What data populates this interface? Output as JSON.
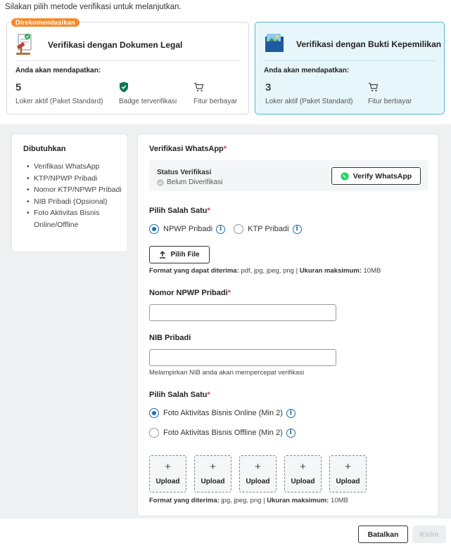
{
  "intro": "Silakan pilih metode verifikasi untuk melanjutkan.",
  "cards": {
    "legal": {
      "badge": "Direkomendasikan",
      "title": "Verifikasi dengan Dokumen Legal",
      "subtitle": "Anda akan mendapatkan:",
      "benefit_count": "5",
      "benefit_count_label": "Loker aktif (Paket Standard)",
      "badge_label": "Badge terverifikasi",
      "paid_label": "Fitur berbayar"
    },
    "owner": {
      "title": "Verifikasi dengan Bukti Kepemilikan",
      "subtitle": "Anda akan mendapatkan:",
      "benefit_count": "3",
      "benefit_count_label": "Loker aktif (Paket Standard)",
      "paid_label": "Fitur berbayar",
      "selected": true
    }
  },
  "sidebar": {
    "title": "Dibutuhkan",
    "items": [
      "Verifikasi WhatsApp",
      "KTP/NPWP Pribadi",
      "Nomor KTP/NPWP Pribadi",
      "NIB Pribadi (Opsional)",
      "Foto Aktivitas Bisnis Online/Offline"
    ]
  },
  "form": {
    "whatsapp": {
      "title": "Verifikasi WhatsApp",
      "status_label": "Status Verifikasi",
      "status_value": "Belum Diverifikasi",
      "button": "Verify WhatsApp"
    },
    "id_choice": {
      "title": "Pilih Salah Satu",
      "option_1": "NPWP Pribadi",
      "option_2": "KTP Pribadi",
      "selected": "NPWP Pribadi"
    },
    "file_button": "Pilih File",
    "file_hint_label": "Format yang dapat diterima:",
    "file_hint_formats": "pdf, jpg, jpeg, png",
    "file_hint_sep": "|",
    "file_hint_size_label": "Ukuran maksimum:",
    "file_hint_size": "10MB",
    "npwp_label": "Nomor NPWP Pribadi",
    "npwp_value": "",
    "nib_label": "NIB Pribadi",
    "nib_value": "",
    "nib_hint": "Melampirkan NIB anda akan mempercepat verifikasi",
    "photo_choice": {
      "title": "Pilih Salah Satu",
      "option_1": "Foto Aktivitas Bisnis Online (Min 2)",
      "option_2": "Foto Aktivitas Bisnis Offline (Min 2)",
      "selected": "Foto Aktivitas Bisnis Online (Min 2)"
    },
    "upload_label": "Upload",
    "upload_plus": "+",
    "upload_hint_label": "Format yang diterima:",
    "upload_hint_formats": "jpg, jpeg, png",
    "upload_hint_sep": "|",
    "upload_hint_size_label": "Ukuran maksimum:",
    "upload_hint_size": "10MB"
  },
  "footer": {
    "cancel": "Batalkan",
    "submit": "Kirim"
  },
  "colors": {
    "accent_blue": "#1e6ea8",
    "badge_orange": "#f48b2d",
    "selected_card_bg": "#e6f6fb",
    "selected_card_border": "#58b6d1",
    "required_red": "#e23b3b",
    "whatsapp_green": "#25d366",
    "shield_green": "#0f7a4f"
  }
}
